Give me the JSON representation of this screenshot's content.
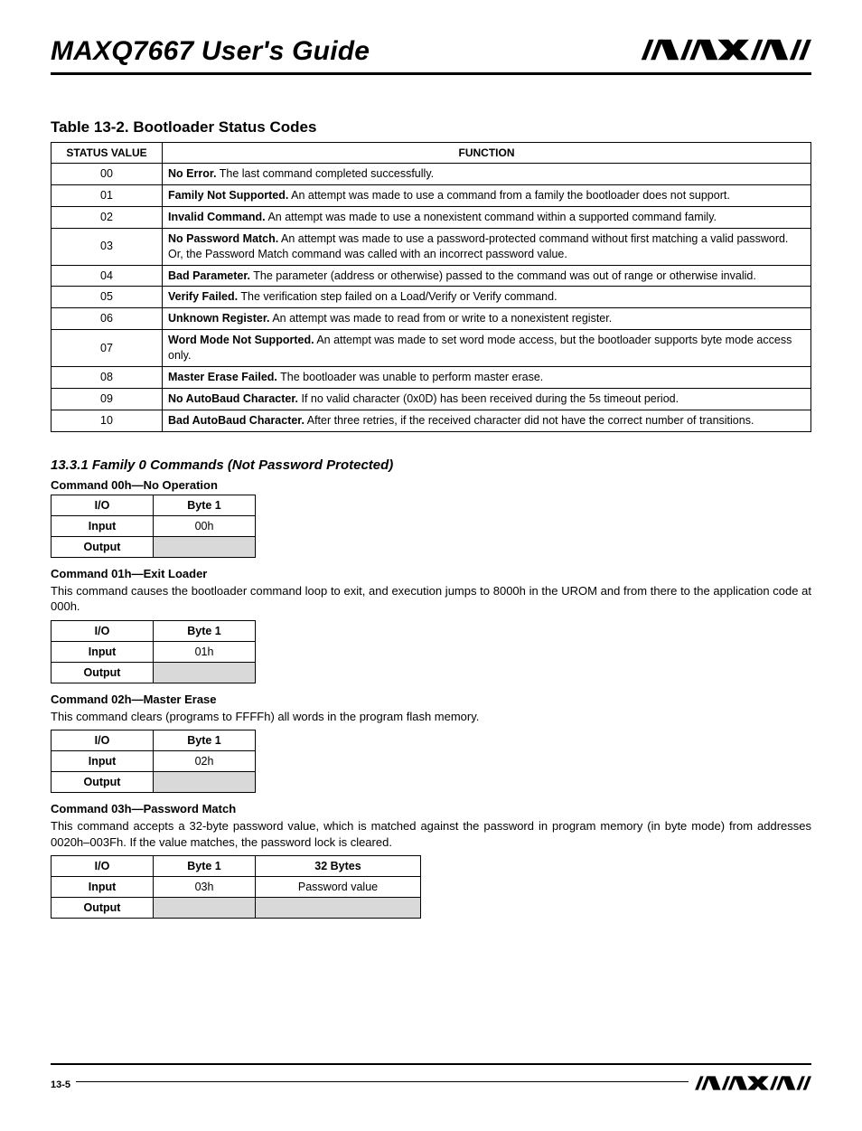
{
  "header": {
    "title": "MAXQ7667 User's Guide",
    "logo_name": "maxim-logo"
  },
  "status_table": {
    "title": "Table 13-2. Bootloader Status Codes",
    "columns": [
      "STATUS VALUE",
      "FUNCTION"
    ],
    "rows": [
      {
        "code": "00",
        "bold": "No Error.",
        "rest": " The last command completed successfully."
      },
      {
        "code": "01",
        "bold": "Family Not Supported.",
        "rest": " An attempt was made to use a command from a family the bootloader does not support."
      },
      {
        "code": "02",
        "bold": "Invalid Command.",
        "rest": " An attempt was made to use a nonexistent command within a supported command family."
      },
      {
        "code": "03",
        "bold": "No Password Match.",
        "rest": " An attempt was made to use a password-protected command without first matching a valid password. Or, the Password Match command was called with an incorrect password value."
      },
      {
        "code": "04",
        "bold": "Bad Parameter.",
        "rest": " The parameter (address or otherwise) passed to the command was out of range or otherwise invalid."
      },
      {
        "code": "05",
        "bold": "Verify Failed.",
        "rest": " The verification step failed on a Load/Verify or Verify command."
      },
      {
        "code": "06",
        "bold": "Unknown Register.",
        "rest": " An attempt was made to read from or write to a nonexistent register."
      },
      {
        "code": "07",
        "bold": "Word Mode Not Supported.",
        "rest": " An attempt was made to set word mode access, but the bootloader supports byte mode access only."
      },
      {
        "code": "08",
        "bold": "Master Erase Failed.",
        "rest": " The bootloader was unable to perform master erase."
      },
      {
        "code": "09",
        "bold": "No AutoBaud Character.",
        "rest": " If no valid character (0x0D) has been received during the 5s timeout period."
      },
      {
        "code": "10",
        "bold": "Bad AutoBaud Character.",
        "rest": " After three retries, if the received character did not have the correct number of transitions."
      }
    ]
  },
  "section": {
    "heading": "13.3.1 Family 0 Commands (Not Password Protected)"
  },
  "cmd00": {
    "heading": "Command 00h—No Operation",
    "cols": [
      "I/O",
      "Byte 1"
    ],
    "input_label": "Input",
    "input_b1": "00h",
    "output_label": "Output"
  },
  "cmd01": {
    "heading": "Command 01h—Exit Loader",
    "desc": "This command causes the bootloader command loop to exit, and execution jumps to 8000h in the UROM and from there to the application code at 000h.",
    "cols": [
      "I/O",
      "Byte 1"
    ],
    "input_label": "Input",
    "input_b1": "01h",
    "output_label": "Output"
  },
  "cmd02": {
    "heading": "Command 02h—Master Erase",
    "desc": "This command clears (programs to FFFFh) all words in the program flash memory.",
    "cols": [
      "I/O",
      "Byte 1"
    ],
    "input_label": "Input",
    "input_b1": "02h",
    "output_label": "Output"
  },
  "cmd03": {
    "heading": "Command 03h—Password Match",
    "desc": "This command accepts a 32-byte password value, which is matched against the password in program memory (in byte mode) from addresses 0020h–003Fh. If the value matches, the password lock is cleared.",
    "cols": [
      "I/O",
      "Byte 1",
      "32 Bytes"
    ],
    "input_label": "Input",
    "input_b1": "03h",
    "input_extra": "Password value",
    "output_label": "Output"
  },
  "footer": {
    "page": "13-5",
    "logo_name": "maxim-logo"
  }
}
